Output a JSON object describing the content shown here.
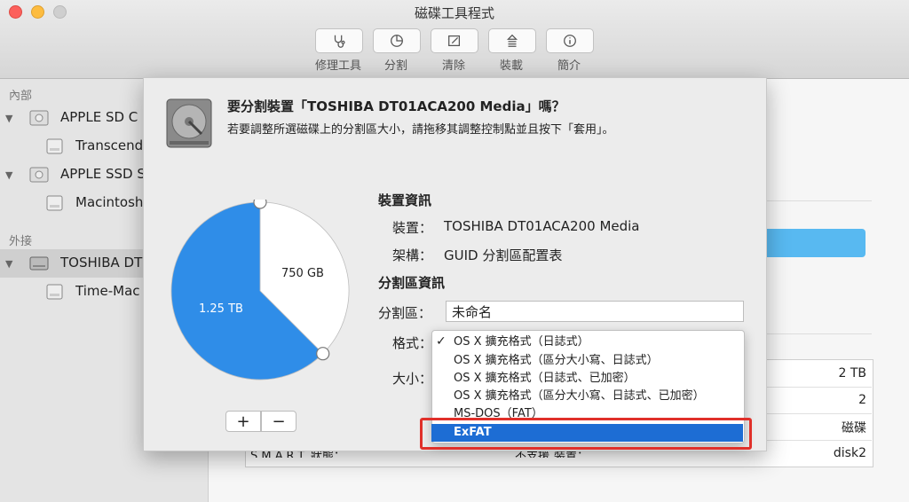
{
  "window": {
    "title": "磁碟工具程式",
    "toolbar": [
      {
        "label": "修理工具",
        "icon": "stethoscope-icon"
      },
      {
        "label": "分割",
        "icon": "partition-icon"
      },
      {
        "label": "清除",
        "icon": "erase-icon"
      },
      {
        "label": "裝載",
        "icon": "mount-icon"
      },
      {
        "label": "簡介",
        "icon": "info-icon"
      }
    ]
  },
  "sidebar": {
    "internal_header": "內部",
    "external_header": "外接",
    "items": [
      {
        "label": "APPLE SD C",
        "level": 0
      },
      {
        "label": "Transcend",
        "level": 1
      },
      {
        "label": "APPLE SSD S",
        "level": 0
      },
      {
        "label": "Macintosh",
        "level": 1
      },
      {
        "label": "TOSHIBA DT",
        "level": 0,
        "selected": true
      },
      {
        "label": "Time-Mac",
        "level": 1
      }
    ]
  },
  "sheet": {
    "title": "要分割裝置「TOSHIBA DT01ACA200 Media」嗎？",
    "subtitle": "若要調整所選磁碟上的分割區大小，請拖移其調整控制點並且按下「套用」。",
    "pie": {
      "slices": [
        {
          "label": "1.25 TB",
          "value": 1250,
          "color": "#2f8de8"
        },
        {
          "label": "750 GB",
          "value": 750,
          "color": "#ffffff"
        }
      ]
    },
    "add_label": "+",
    "remove_label": "−",
    "device_info_title": "裝置資訊",
    "device_label": "裝置：",
    "device_value": "TOSHIBA DT01ACA200 Media",
    "scheme_label": "架構：",
    "scheme_value": "GUID 分割區配置表",
    "partition_info_title": "分割區資訊",
    "partition_label": "分割區：",
    "partition_value": "未命名",
    "format_label": "格式：",
    "size_label": "大小：",
    "format_options": [
      {
        "label": "OS X 擴充格式（日誌式）",
        "checked": true
      },
      {
        "label": "OS X 擴充格式（區分大小寫、日誌式）"
      },
      {
        "label": "OS X 擴充格式（日誌式、已加密）"
      },
      {
        "label": "OS X 擴充格式（區分大小寫、日誌式、已加密）"
      },
      {
        "label": "MS-DOS（FAT）"
      },
      {
        "label": "ExFAT",
        "highlighted": true
      }
    ]
  },
  "info_values": [
    "2 TB",
    "2",
    "磁碟",
    "disk2"
  ],
  "info_bottom_left": "S.M.A.R.T. 狀態：",
  "info_bottom_mid": "不支援",
  "info_bottom_right": "裝置："
}
